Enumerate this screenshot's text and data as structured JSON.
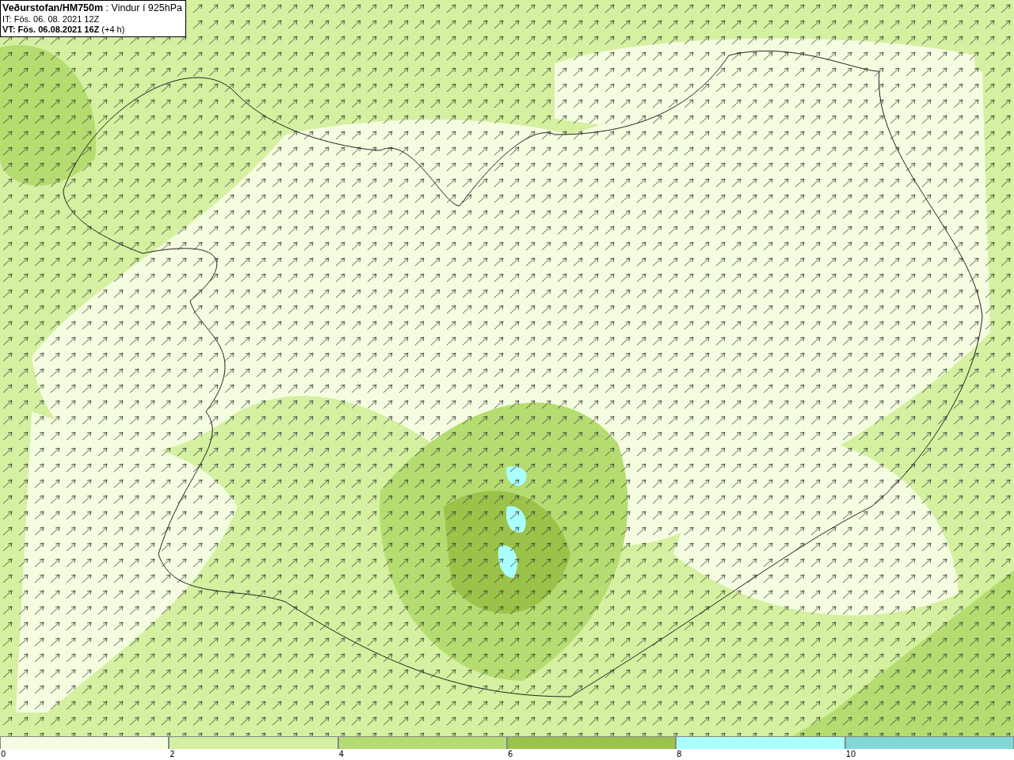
{
  "header": {
    "lines": [
      "**Veðurstofan/HM750m** : Vindur í 925hPa",
      "IT: Fös. 06. 08. 2021 12Z",
      "**VT: Fös. 06.08.2021 16Z** (+4 h)"
    ]
  },
  "legend": [
    {
      "label": "0",
      "color": "#f5fde0"
    },
    {
      "label": "2",
      "color": "#d4f0a0"
    },
    {
      "label": "4",
      "color": "#b5dc70"
    },
    {
      "label": "6",
      "color": "#9bc34a"
    },
    {
      "label": "8",
      "color": "#aaffff"
    },
    {
      "label": "10",
      "color": "#80d8d8"
    }
  ]
}
